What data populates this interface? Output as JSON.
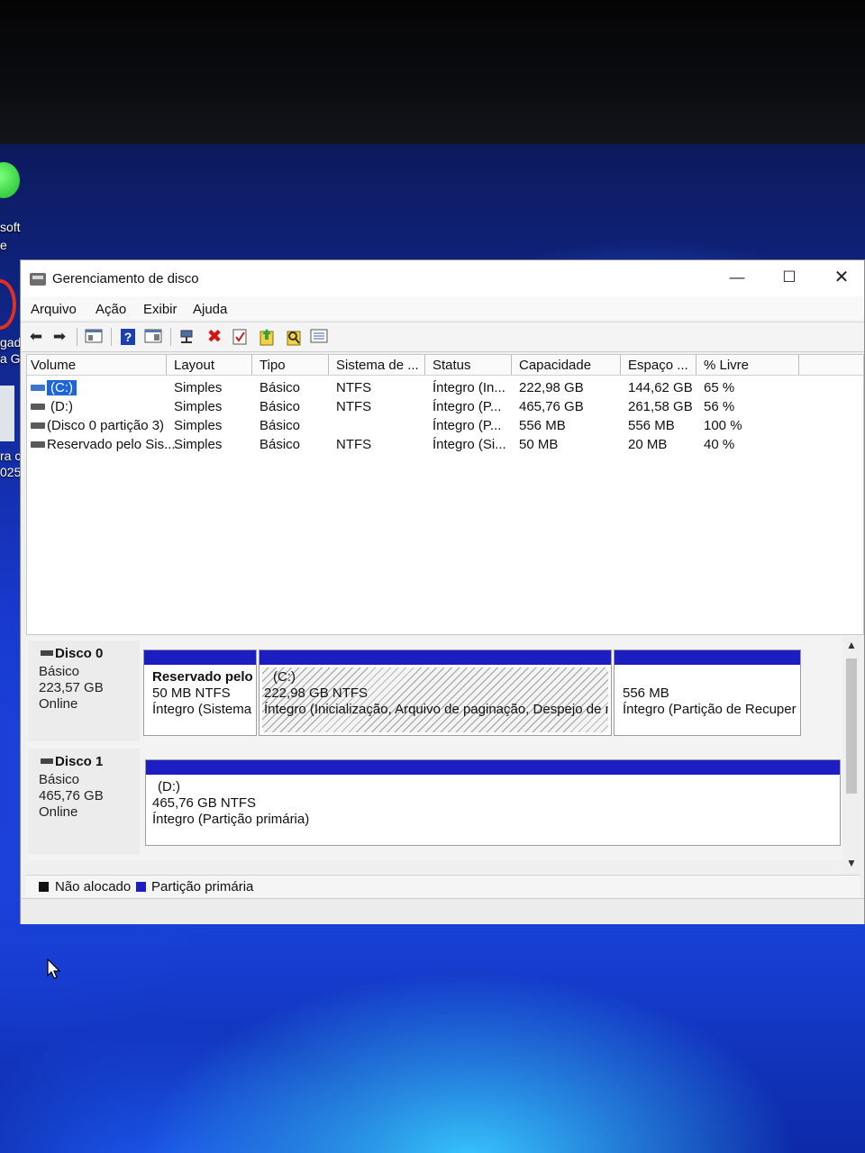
{
  "desktop": {
    "labels": [
      "soft",
      "e",
      "gad",
      "a G",
      "ra c",
      "025."
    ]
  },
  "window": {
    "title": "Gerenciamento de disco",
    "min_glyph": "—",
    "max_glyph": "☐",
    "close_glyph": "✕"
  },
  "menu": [
    "Arquivo",
    "Ação",
    "Exibir",
    "Ajuda"
  ],
  "toolbar_icons": [
    "back-arrow-icon",
    "forward-arrow-icon",
    "console-tree-icon",
    "help-icon",
    "properties-icon",
    "connect-icon",
    "delete-icon",
    "check-icon",
    "up-arrow-icon",
    "search-disk-icon",
    "list-view-icon"
  ],
  "volumes": {
    "columns": [
      "Volume",
      "Layout",
      "Tipo",
      "Sistema de ...",
      "Status",
      "Capacidade",
      "Espaço ...",
      "% Livre"
    ],
    "rows": [
      [
        "(C:)",
        "Simples",
        "Básico",
        "NTFS",
        "Íntegro (In...",
        "222,98 GB",
        "144,62 GB",
        "65 %"
      ],
      [
        "(D:)",
        "Simples",
        "Básico",
        "NTFS",
        "Íntegro (P...",
        "465,76 GB",
        "261,58 GB",
        "56 %"
      ],
      [
        "(Disco 0 partição 3)",
        "Simples",
        "Básico",
        "",
        "Íntegro (P...",
        "556 MB",
        "556 MB",
        "100 %"
      ],
      [
        "Reservado pelo Sis...",
        "Simples",
        "Básico",
        "NTFS",
        "Íntegro (Si...",
        "50 MB",
        "20 MB",
        "40 %"
      ]
    ]
  },
  "disks": [
    {
      "name": "Disco 0",
      "type": "Básico",
      "size": "223,57 GB",
      "state": "Online",
      "partitions": [
        {
          "lines": [
            "Reservado pelo",
            "50 MB NTFS",
            "Íntegro (Sistema"
          ]
        },
        {
          "lines": [
            "(C:)",
            "222,98 GB NTFS",
            "Íntegro (Inicialização, Arquivo de paginação, Despejo de m"
          ]
        },
        {
          "lines": [
            "",
            "556 MB",
            "Íntegro (Partição de Recuper"
          ]
        }
      ]
    },
    {
      "name": "Disco 1",
      "type": "Básico",
      "size": "465,76 GB",
      "state": "Online",
      "partitions": [
        {
          "lines": [
            "(D:)",
            "465,76 GB NTFS",
            "Íntegro (Partição primária)"
          ]
        }
      ]
    }
  ],
  "legend": {
    "unallocated": "Não alocado",
    "primary": "Partição primária",
    "unallocated_color": "#111111",
    "primary_color": "#1c1ec2"
  },
  "scroll": {
    "up": "▲",
    "down": "▼"
  }
}
